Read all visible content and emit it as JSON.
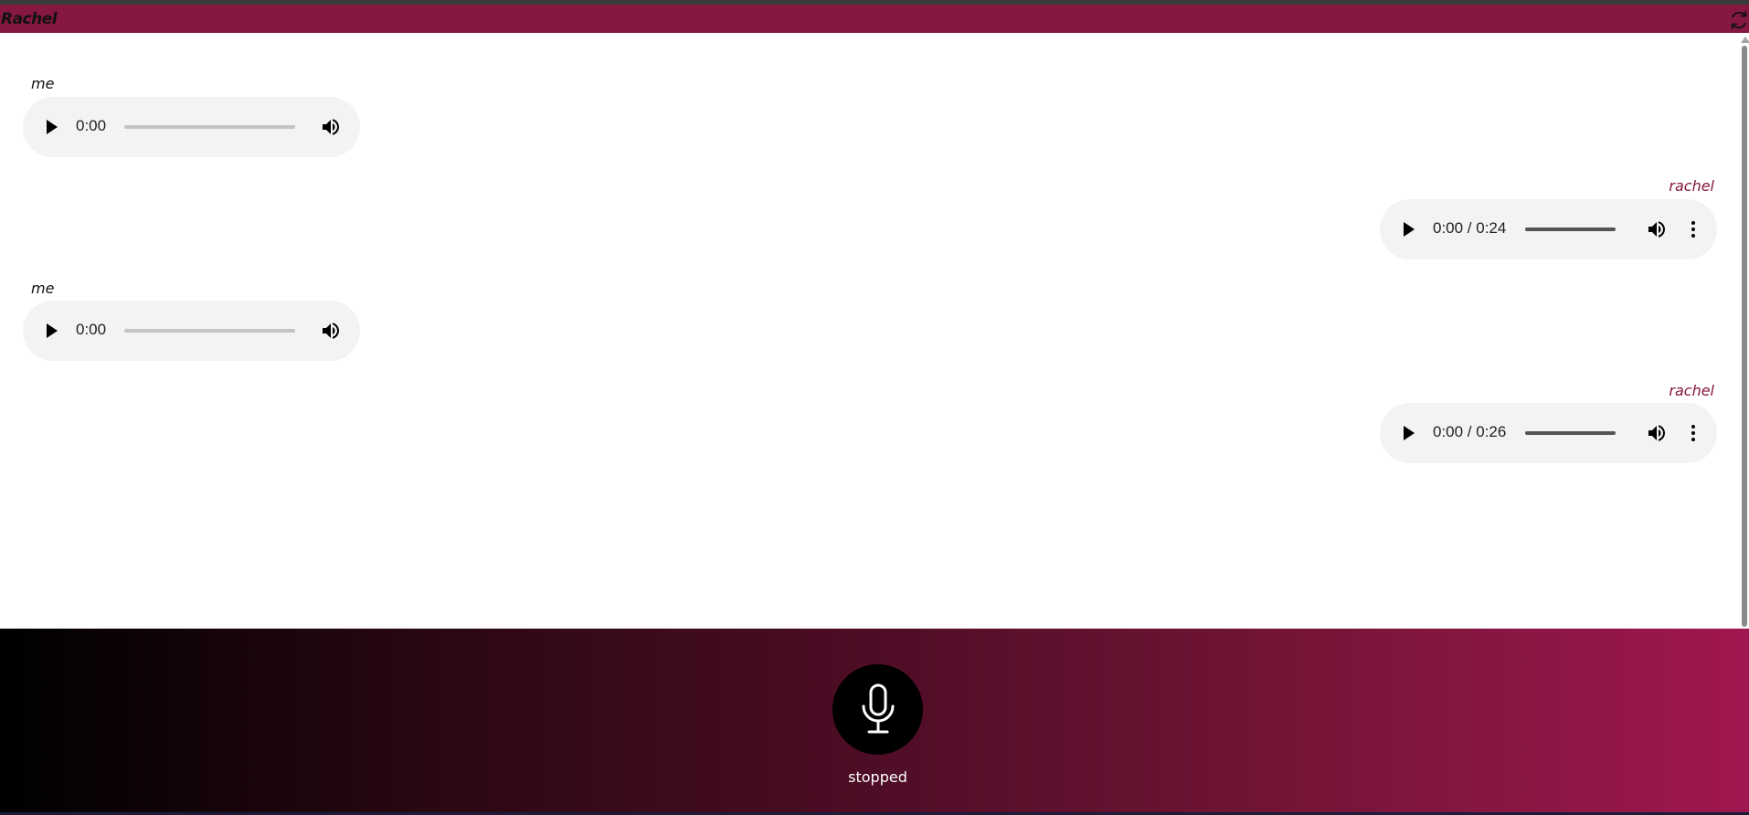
{
  "header": {
    "title": "Rachel",
    "refresh_icon": "refresh-icon"
  },
  "messages": [
    {
      "sender": "me",
      "side": "left",
      "time": "0:00",
      "has_duration": false,
      "has_menu": false
    },
    {
      "sender": "rachel",
      "side": "right",
      "time": "0:00 / 0:24",
      "has_duration": true,
      "has_menu": true
    },
    {
      "sender": "me",
      "side": "left",
      "time": "0:00",
      "has_duration": false,
      "has_menu": false
    },
    {
      "sender": "rachel",
      "side": "right",
      "time": "0:00 / 0:26",
      "has_duration": true,
      "has_menu": true
    }
  ],
  "recorder": {
    "icon": "microphone-icon",
    "status": "stopped"
  },
  "colors": {
    "brand": "#851740",
    "player_bg": "#f1f3f4",
    "gradient_start": "#000000",
    "gradient_end": "#a01750"
  }
}
